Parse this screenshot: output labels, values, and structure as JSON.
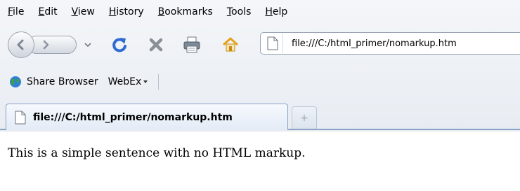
{
  "menubar": {
    "items": [
      "File",
      "Edit",
      "View",
      "History",
      "Bookmarks",
      "Tools",
      "Help"
    ]
  },
  "toolbar": {
    "icons": [
      "back-icon",
      "forward-icon",
      "history-dropdown-icon",
      "reload-icon",
      "stop-icon",
      "print-icon",
      "home-icon"
    ],
    "accent_reload": "#2f6bd0",
    "accent_stop": "#8a8f96",
    "accent_home": "#e5a21a"
  },
  "urlbar": {
    "value": "file:///C:/html_primer/nomarkup.htm"
  },
  "bookmarks": {
    "items": [
      {
        "label": "Share Browser",
        "icon": "globe-icon"
      },
      {
        "label": "WebEx",
        "icon": "dropdown-arrow-icon"
      }
    ]
  },
  "tabs": {
    "active_title": "file:///C:/html_primer/nomarkup.htm",
    "new_tab_glyph": "+"
  },
  "page": {
    "text": "This is a simple sentence with no HTML markup."
  }
}
